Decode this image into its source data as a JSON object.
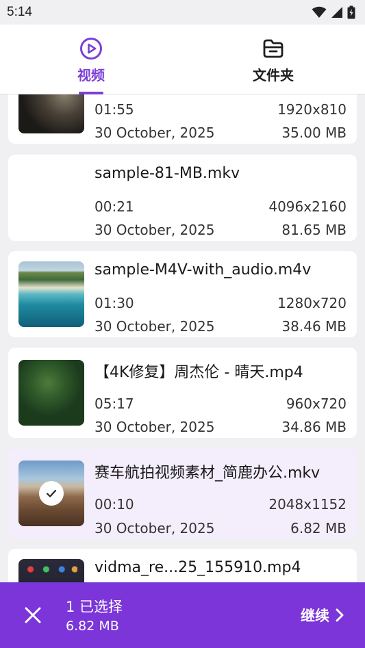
{
  "status_bar": {
    "time": "5:14"
  },
  "tabs": [
    {
      "label": "视频",
      "icon": "play-circle-icon",
      "active": true
    },
    {
      "label": "文件夹",
      "icon": "folder-icon",
      "active": false
    }
  ],
  "colors": {
    "accent": "#7b3fd6",
    "action_bar": "#7b35d8",
    "selected_card": "#f3edfc"
  },
  "videos": [
    {
      "name": "",
      "duration": "01:55",
      "resolution": "1920x810",
      "date": "30 October, 2025",
      "size": "35.00 MB",
      "selected": false
    },
    {
      "name": "sample-81-MB.mkv",
      "duration": "00:21",
      "resolution": "4096x2160",
      "date": "30 October, 2025",
      "size": "81.65 MB",
      "selected": false
    },
    {
      "name": "sample-M4V-with_audio.m4v",
      "duration": "01:30",
      "resolution": "1280x720",
      "date": "30 October, 2025",
      "size": "38.46 MB",
      "selected": false
    },
    {
      "name": "【4K修复】周杰伦 - 晴天.mp4",
      "duration": "05:17",
      "resolution": "960x720",
      "date": "30 October, 2025",
      "size": "34.86 MB",
      "selected": false
    },
    {
      "name": "赛车航拍视频素材_简鹿办公.mkv",
      "duration": "00:10",
      "resolution": "2048x1152",
      "date": "30 October, 2025",
      "size": "6.82 MB",
      "selected": true
    },
    {
      "name": "vidma_re...25_155910.mp4",
      "duration": "",
      "resolution": "",
      "date": "",
      "size": "",
      "selected": false
    }
  ],
  "selection": {
    "count_label": "1 已选择",
    "size": "6.82 MB",
    "continue_label": "继续"
  }
}
